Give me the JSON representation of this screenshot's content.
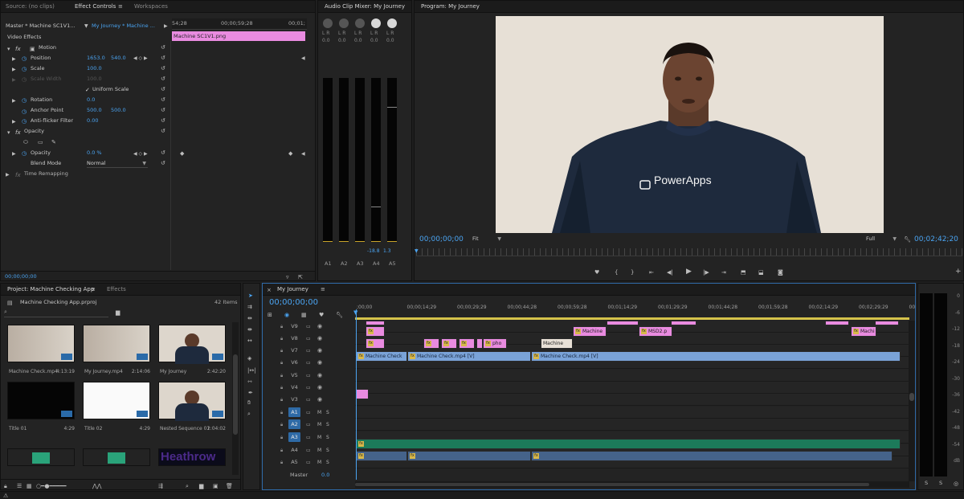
{
  "effect_controls": {
    "tabs": [
      "Source: (no clips)",
      "Effect Controls",
      "Workspaces"
    ],
    "master_label": "Master * Machine SC1V1...",
    "sequence_label": "My Journey * Machine ...",
    "time_start": "54;28",
    "time_mid": "00;00;59;28",
    "time_end": "00;01;",
    "clip_name": "Machine SC1V1.png",
    "section": "Video Effects",
    "motion": "Motion",
    "position_label": "Position",
    "position_x": "1653.0",
    "position_y": "540.0",
    "scale_label": "Scale",
    "scale_val": "100.0",
    "scale_width_label": "Scale Width",
    "scale_width_val": "100.0",
    "uniform_scale": "Uniform Scale",
    "rotation_label": "Rotation",
    "rotation_val": "0.0",
    "anchor_label": "Anchor Point",
    "anchor_x": "500.0",
    "anchor_y": "500.0",
    "antiflicker_label": "Anti-flicker Filter",
    "antiflicker_val": "0.00",
    "opacity_section": "Opacity",
    "opacity_label": "Opacity",
    "opacity_val": "0.0 %",
    "blend_label": "Blend Mode",
    "blend_val": "Normal",
    "time_remap": "Time Remapping",
    "bottom_time": "00;00;00;00"
  },
  "audio_mixer": {
    "title": "Audio Clip Mixer: My Journey",
    "channels": [
      {
        "name": "A1",
        "value": "0.0",
        "peak": "",
        "knob_active": false
      },
      {
        "name": "A2",
        "value": "0.0",
        "peak": "",
        "knob_active": false
      },
      {
        "name": "A3",
        "value": "0.0",
        "peak": "",
        "knob_active": false
      },
      {
        "name": "A4",
        "value": "0.0",
        "peak": "-18.8",
        "knob_active": true
      },
      {
        "name": "A5",
        "value": "0.0",
        "peak": "1.3",
        "knob_active": true
      }
    ],
    "lr": "L R"
  },
  "program": {
    "title": "Program: My Journey",
    "timecode": "00;00;00;00",
    "fit": "Fit",
    "quality": "Full",
    "duration": "00;02;42;20",
    "shirt_text": "PowerApps"
  },
  "project": {
    "tabs": [
      "Project: Machine Checking App",
      "Effects"
    ],
    "file": "Machine Checking App.prproj",
    "items_count": "42 Items",
    "items": [
      {
        "name": "Machine Check.mp4",
        "duration": "4:13:19",
        "kind": "wall"
      },
      {
        "name": "My Journey.mp4",
        "duration": "2:14:06",
        "kind": "wall"
      },
      {
        "name": "My Journey",
        "duration": "2:42:20",
        "kind": "person"
      },
      {
        "name": "Title 01",
        "duration": "4:29",
        "kind": "black"
      },
      {
        "name": "Title 02",
        "duration": "4:29",
        "kind": "white"
      },
      {
        "name": "Nested Sequence 01",
        "duration": "2:04:02",
        "kind": "person"
      },
      {
        "name": "",
        "duration": "",
        "kind": "audio"
      },
      {
        "name": "",
        "duration": "",
        "kind": "audio"
      },
      {
        "name": "",
        "duration": "",
        "kind": "heathrow",
        "label": "Heathrow"
      }
    ]
  },
  "timeline": {
    "tab": "My Journey",
    "timecode": "00;00;00;00",
    "ruler": [
      ";00;00",
      "00;00;14;29",
      "00;00;29;29",
      "00;00;44;28",
      "00;00;59;28",
      "00;01;14;29",
      "00;01;29;29",
      "00;01;44;28",
      "00;01;59;28",
      "00;02;14;29",
      "00;02;29;29",
      "00;02"
    ],
    "tracks": [
      "V9",
      "V8",
      "V7",
      "V6",
      "V5",
      "V4",
      "V3",
      "A1",
      "A2",
      "A3",
      "A4",
      "A5"
    ],
    "master": "Master",
    "master_val": "0.0",
    "m": "M",
    "s": "S",
    "clip_labels": {
      "v8_a": "Machine",
      "v8_b": "MSD2.p",
      "v8_c": "Machi",
      "v7_a": "pho",
      "v7_b": "Machine",
      "v6_a": "Machine Check",
      "v6_b": "Machine Check.mp4 [V]",
      "v6_c": "Machine Check.mp4 [V]"
    }
  },
  "meter": {
    "scale": [
      "0",
      "-6",
      "-12",
      "-18",
      "-24",
      "-30",
      "-36",
      "-42",
      "-48",
      "-54",
      "dB"
    ],
    "bottom": [
      "S",
      "S"
    ]
  },
  "colors": {
    "accent": "#4aa3f0",
    "video_clip": "#e98be0",
    "seq_clip": "#7aa3d8",
    "audio_clip": "#1c7a5a"
  }
}
